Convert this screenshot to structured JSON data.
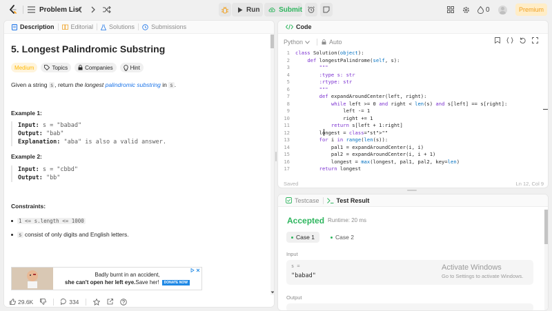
{
  "topbar": {
    "problem_list": "Problem List",
    "run": "Run",
    "submit": "Submit",
    "streak_count": "0",
    "premium": "Premium"
  },
  "left_tabs": [
    "Description",
    "Editorial",
    "Solutions",
    "Submissions"
  ],
  "problem": {
    "title": "5. Longest Palindromic Substring",
    "difficulty": "Medium",
    "chips": [
      "Topics",
      "Companies",
      "Hint"
    ],
    "intro_pre": "Given a string ",
    "intro_s": "s",
    "intro_mid": ", return ",
    "intro_longest": "the longest",
    "intro_link": "palindromic substring",
    "intro_in": " in ",
    "intro_s2": "s",
    "intro_end": ".",
    "example1_title": "Example 1:",
    "example1": [
      {
        "label": "Input:",
        "value": " s = \"babad\""
      },
      {
        "label": "Output:",
        "value": " \"bab\""
      },
      {
        "label": "Explanation:",
        "value": " \"aba\" is also a valid answer."
      }
    ],
    "example2_title": "Example 2:",
    "example2": [
      {
        "label": "Input:",
        "value": " s = \"cbbd\""
      },
      {
        "label": "Output:",
        "value": " \"bb\""
      }
    ],
    "constraints_title": "Constraints:",
    "constraint1": "1 <= s.length <= 1000",
    "constraint2_code": "s",
    "constraint2_text": " consist of only digits and English letters."
  },
  "ad": {
    "line1": "Badly burnt in an accident,",
    "line2": "she can't open her left eye.",
    "line2b": " Save her!",
    "button": "DONATE NOW"
  },
  "left_footer": {
    "likes": "29.6K",
    "comments": "334"
  },
  "code_panel": {
    "tab": "Code",
    "language": "Python",
    "mode": "Auto",
    "status": "Saved",
    "cursor": "Ln 12, Col 9",
    "lines": [
      "class Solution(object):",
      "    def longestPalindrome(self, s):",
      "        \"\"\"",
      "        :type s: str",
      "        :rtype: str",
      "        \"\"\"",
      "        def expandAroundCenter(left, right):",
      "            while left >= 0 and right < len(s) and s[left] == s[right]:",
      "                left -= 1",
      "                right += 1",
      "            return s[left + 1:right]",
      "        longest = \"\"",
      "        for i in range(len(s)):",
      "            pal1 = expandAroundCenter(i, i)",
      "            pal2 = expandAroundCenter(i, i + 1)",
      "            longest = max(longest, pal1, pal2, key=len)",
      "        return longest"
    ]
  },
  "result_panel": {
    "tab_testcase": "Testcase",
    "tab_result": "Test Result",
    "status": "Accepted",
    "runtime": "Runtime: 20 ms",
    "cases": [
      "Case 1",
      "Case 2"
    ],
    "input_label": "Input",
    "input_var": "s =",
    "input_value": "\"babad\"",
    "output_label": "Output"
  },
  "watermark": {
    "line1": "Activate Windows",
    "line2": "Go to Settings to activate Windows."
  },
  "colors": {
    "accepted": "#2db55d",
    "medium": "#ffb800",
    "submit": "#2db55d",
    "premium": "#f0a020"
  }
}
